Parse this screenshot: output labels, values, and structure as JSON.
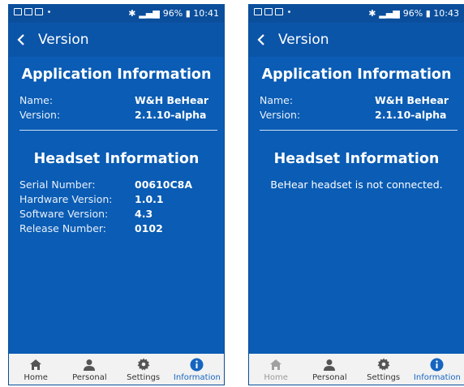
{
  "phones": [
    {
      "status_time": "96% ▮ 10:41",
      "title": "Version",
      "app_section": {
        "heading": "Application Information",
        "rows": [
          {
            "label": "Name:",
            "value": "W&H BeHear"
          },
          {
            "label": "Version:",
            "value": "2.1.10-alpha"
          }
        ]
      },
      "headset_section": {
        "heading": "Headset Information",
        "rows": [
          {
            "label": "Serial Number:",
            "value": "00610C8A"
          },
          {
            "label": "Hardware Version:",
            "value": "1.0.1"
          },
          {
            "label": "Software Version:",
            "value": "4.3"
          },
          {
            "label": "Release Number:",
            "value": "0102"
          }
        ]
      },
      "nav": [
        {
          "label": "Home",
          "icon": "home-icon"
        },
        {
          "label": "Personal",
          "icon": "person-icon"
        },
        {
          "label": "Settings",
          "icon": "gear-icon"
        },
        {
          "label": "Information",
          "icon": "info-icon",
          "active": true
        }
      ]
    },
    {
      "status_time": "96% ▮ 10:43",
      "title": "Version",
      "app_section": {
        "heading": "Application Information",
        "rows": [
          {
            "label": "Name:",
            "value": "W&H BeHear"
          },
          {
            "label": "Version:",
            "value": "2.1.10-alpha"
          }
        ]
      },
      "headset_section": {
        "heading": "Headset Information",
        "message": "BeHear headset is not connected."
      },
      "nav": [
        {
          "label": "Home",
          "icon": "home-icon"
        },
        {
          "label": "Personal",
          "icon": "person-icon"
        },
        {
          "label": "Settings",
          "icon": "gear-icon"
        },
        {
          "label": "Information",
          "icon": "info-icon",
          "active": true
        }
      ]
    }
  ],
  "colors": {
    "background": "#0a5cb4",
    "app_bar": "#0b55a9",
    "active_tab": "#1565c0",
    "nav_bg": "#f2f2f2"
  }
}
